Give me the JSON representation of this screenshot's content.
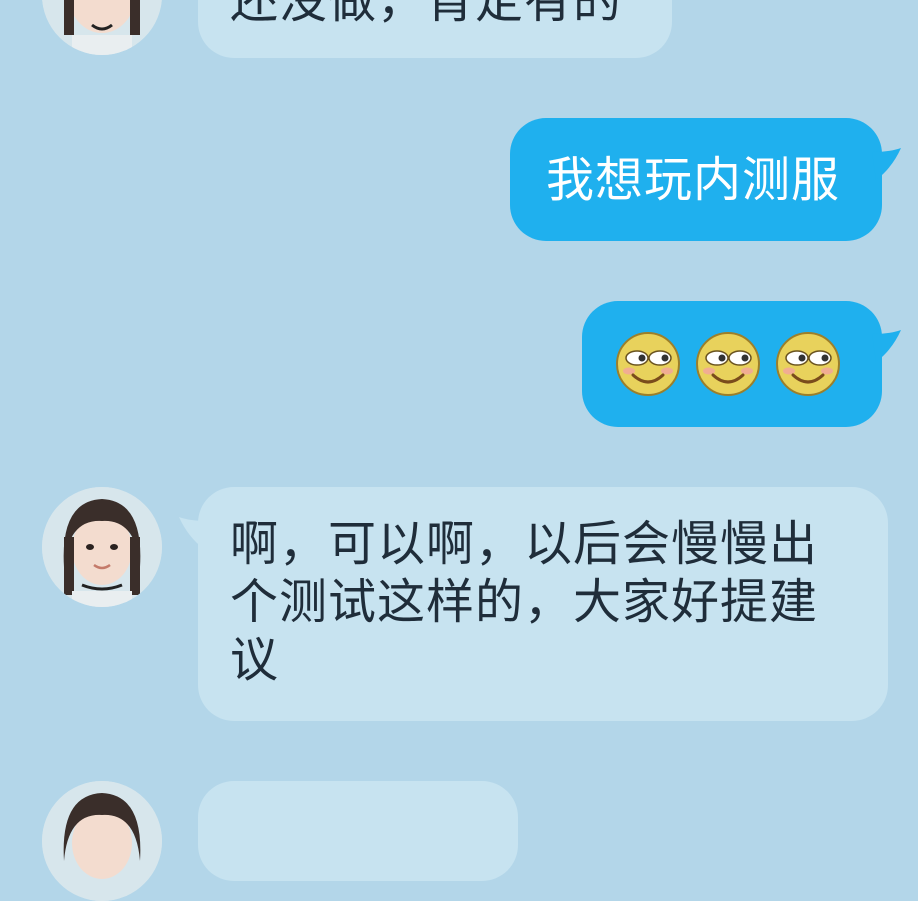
{
  "messages": [
    {
      "side": "in",
      "text": "还没做，肯定有的"
    },
    {
      "side": "out",
      "text": "我想玩内测服"
    },
    {
      "side": "out",
      "emoji": [
        "grinning-sideeye-emoji",
        "grinning-sideeye-emoji",
        "grinning-sideeye-emoji"
      ]
    },
    {
      "side": "in",
      "text": "啊，可以啊，以后会慢慢出个测试这样的，大家好提建议"
    },
    {
      "side": "in",
      "text": ""
    }
  ],
  "colors": {
    "background": "#b3d6e9",
    "incoming_bubble": "#c7e3f0",
    "outgoing_bubble": "#1fb0ee",
    "incoming_text": "#1f2d3a",
    "outgoing_text": "#ffffff"
  }
}
